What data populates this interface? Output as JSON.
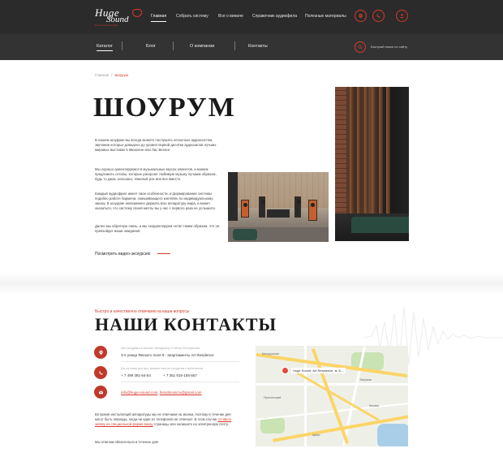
{
  "brand": {
    "name_top": "Huge",
    "name_bottom": "Sound",
    "tagline": "Professional Audio"
  },
  "top_nav": [
    {
      "label": "Главная",
      "active": true
    },
    {
      "label": "Собрать систему",
      "active": false
    },
    {
      "label": "Все о виниле",
      "active": false
    },
    {
      "label": "Справочник аудиофила",
      "active": false
    },
    {
      "label": "Полезные материалы",
      "active": false
    }
  ],
  "header_icons": [
    "cart-icon",
    "phone-icon",
    "user-icon"
  ],
  "sub_nav": [
    {
      "label": "Каталог",
      "active": true
    },
    {
      "label": "Блог",
      "active": false
    },
    {
      "label": "О компании",
      "active": false
    },
    {
      "label": "Контакты",
      "active": false
    }
  ],
  "search": {
    "label": "Быстрый поиск по сайту"
  },
  "breadcrumb": {
    "home": "Главная",
    "separator": "/",
    "current": "Шоурум"
  },
  "showroom": {
    "title": "ШОУРУМ",
    "paragraphs": [
      "В нашем шоуруме вы всегда можете послушать несколько аудиосистем, звучание которых доведено до уровня первой десятки аудиозалов лучших мировых выставок в Мюнхене или Лас Вегасе.",
      "Мы хорошо ориентируемся в музыкальных вкусах клиентов, и можем предложить сетапы, которые раскроют любимую музыку лучшим образом, будь то джаз, классика, тяжелый рок или все вместе.",
      "Каждый аудиофрил имеет свои особенности, и формирование системы подобно работе бармена, смешивающего коктейль по индивидуальному заказу. В шоуруме невозможно держать всю аппаратуру мира, и может оказаться, что систему своей мечты вы у нас с первого раза не услышите.",
      "Далее мы обратную связь, и мы скорректируем сетап таким образом, что он превзойдет ваши ожидания."
    ],
    "video_link": "Посмотреть видео-экскурсию"
  },
  "contacts": {
    "kicker": "Быстро и качественно отвечаем на ваши вопросы",
    "title": "НАШИ КОНТАКТЫ",
    "address_label": "Мы находимся в Москве, неподалеку от метро Белорусская",
    "address": "3-я улица Ямского поля 9 - апартаменты Art Residence",
    "phone_label": "Мы на связи для вас, звоните нам по городским и мобильным",
    "phone1": "+ 7 499 391-64-54",
    "phone2": "+ 7 351 915-155-557",
    "email1": "info@huge-sound.com",
    "email2": "hisndmusicru@gmail.com",
    "note_before": "Во время инсталляций аппаратуры мы не отвечаем на звонки, поэтому в течение дня могут быть периоды, когда ни один из телефонов не отвечает. В этом случае ",
    "note_link": "оставьте заявку на специальной форме внизу",
    "note_after": " страницы или напишите на электронную почту.",
    "note2": "Мы ответим обязательно в течение дня!"
  },
  "map": {
    "pin_label": "Huge Sound, Art Residence, м. Б...",
    "labels": [
      "Белорусская",
      "Тверская",
      "Пресненский",
      "Арбат",
      "Москва"
    ]
  },
  "colors": {
    "accent": "#d63a2a",
    "header_bg": "#2b2b2b",
    "subnav_bg": "#333333"
  }
}
